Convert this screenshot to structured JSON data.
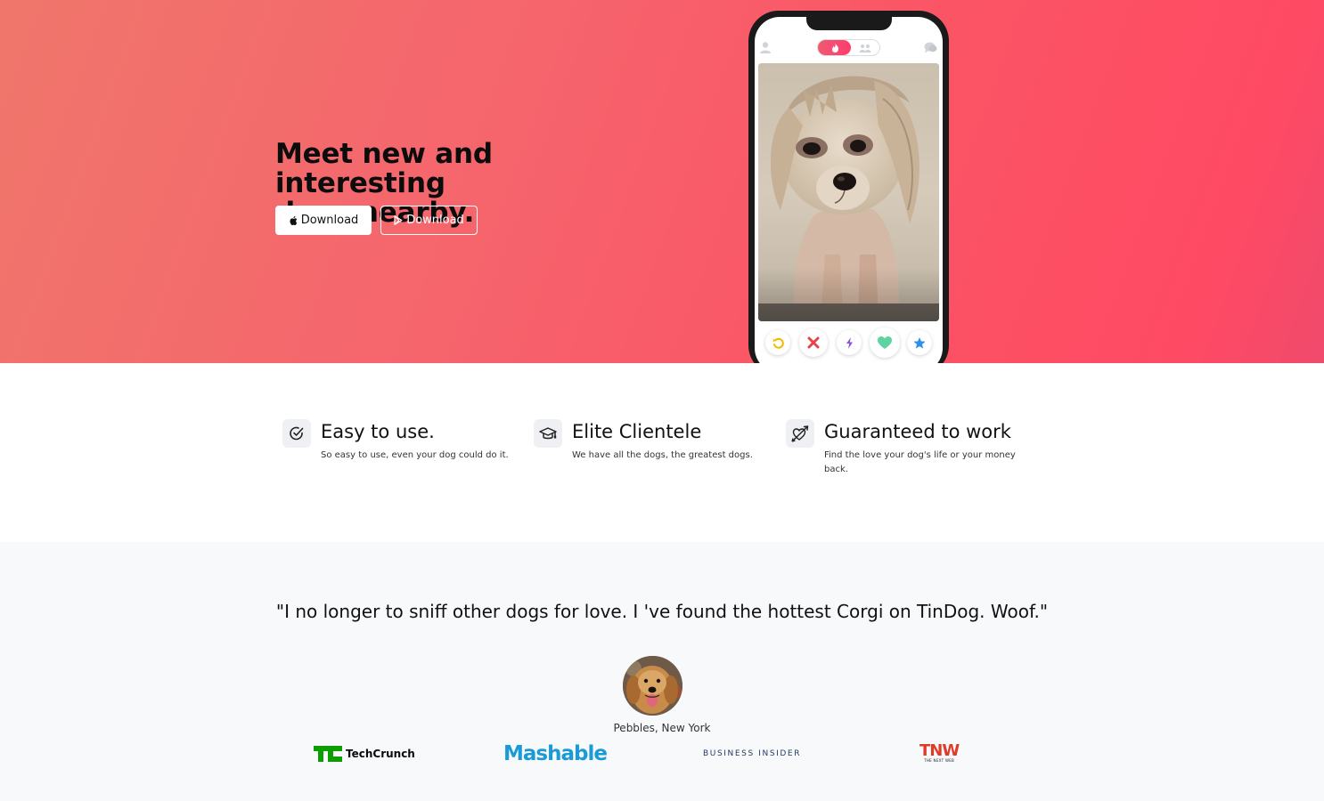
{
  "hero": {
    "title_line1": "Meet new and interesting",
    "title_line2": "dogs nearby.",
    "apple_button_label": "Download",
    "play_button_label": "Download",
    "gradient_colors": [
      "#f0766b",
      "#ff4a64"
    ]
  },
  "phone": {
    "top_bar": {
      "left_icon": "user-icon",
      "toggle_active_icon": "flame-icon",
      "toggle_inactive_icon": "people-icon",
      "right_icon": "chat-icon"
    },
    "photo": "dog-photo",
    "actions": [
      {
        "icon": "rewind-icon",
        "color": "#f5b800"
      },
      {
        "icon": "nope-icon",
        "color": "#e8424b"
      },
      {
        "icon": "boost-icon",
        "color": "#8b4fd6"
      },
      {
        "icon": "like-icon",
        "color": "#5fd3a4"
      },
      {
        "icon": "superlike-icon",
        "color": "#2f8fe6"
      }
    ]
  },
  "features": [
    {
      "icon": "check-circle-icon",
      "title": "Easy to use.",
      "description": "So easy to use, even your dog could do it."
    },
    {
      "icon": "graduation-cap-icon",
      "title": "Elite Clientele",
      "description": "We have all the dogs, the greatest dogs."
    },
    {
      "icon": "heart-arrow-icon",
      "title": "Guaranteed to work",
      "description": "Find the love your dog's life or your money back."
    }
  ],
  "testimonial": {
    "quote": "\"I no longer to sniff other dogs for love. I 've found the hottest Corgi on TinDog. Woof.\"",
    "author": "Pebbles, New York"
  },
  "press": {
    "techcrunch": "TechCrunch",
    "mashable": "Mashable",
    "business_insider": "BUSINESS INSIDER",
    "tnw": "TNW",
    "tnw_sub": "THE NEXT WEB"
  }
}
